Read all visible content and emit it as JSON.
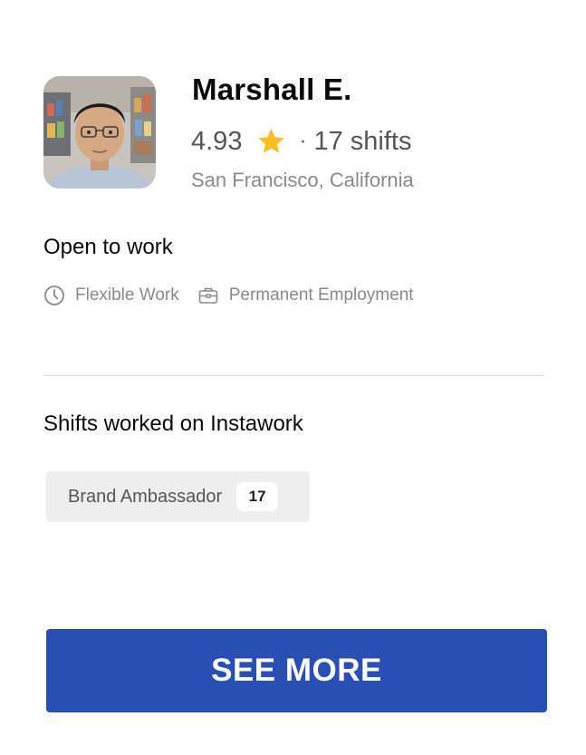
{
  "profile": {
    "name": "Marshall E.",
    "rating": "4.93",
    "separator": "·",
    "shifts_count": "17 shifts",
    "location": "San Francisco, California",
    "avatar_icon": "worker-photo",
    "rating_icon": "star-icon",
    "star_color": "#F5BF26"
  },
  "open_to_work": {
    "title": "Open to work",
    "tags": [
      {
        "label": "Flexible Work",
        "icon": "clock-icon"
      },
      {
        "label": "Permanent Employment",
        "icon": "briefcase-icon"
      }
    ]
  },
  "shifts_worked": {
    "title": "Shifts worked on Instawork",
    "roles": [
      {
        "label": "Brand Ambassador",
        "count": "17"
      }
    ]
  },
  "actions": {
    "see_more_label": "SEE MORE",
    "button_color": "#2A4FB4"
  }
}
